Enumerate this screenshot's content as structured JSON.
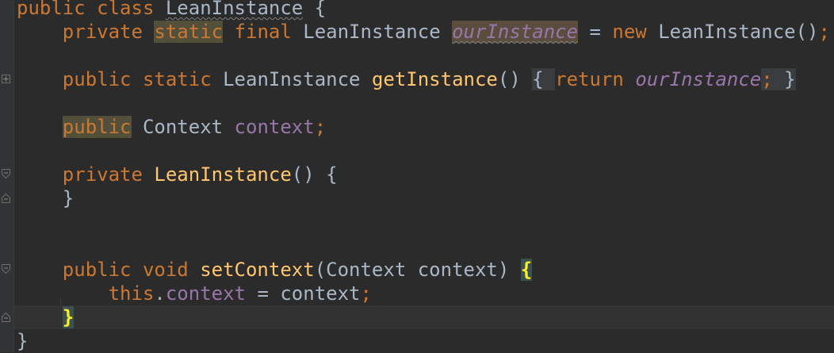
{
  "editor": {
    "lines": [
      {
        "parts": [
          {
            "t": "public class ",
            "c": "kw"
          },
          {
            "t": "LeanInstance",
            "c": "squiggle"
          },
          {
            "t": " {",
            "c": ""
          }
        ]
      },
      {
        "parts": [
          {
            "t": "    ",
            "c": ""
          },
          {
            "t": "private ",
            "c": "kw"
          },
          {
            "t": "static",
            "c": "kw hl-usage"
          },
          {
            "t": " ",
            "c": ""
          },
          {
            "t": "final ",
            "c": "kw"
          },
          {
            "t": "LeanInstance ",
            "c": ""
          },
          {
            "t": "ourInstance",
            "c": "fld it hl-ref squiggle"
          },
          {
            "t": " = ",
            "c": ""
          },
          {
            "t": "new ",
            "c": "kw"
          },
          {
            "t": "LeanInstance()",
            "c": ""
          },
          {
            "t": ";",
            "c": "kw"
          }
        ]
      },
      {
        "parts": []
      },
      {
        "parts": [
          {
            "t": "    ",
            "c": ""
          },
          {
            "t": "public static ",
            "c": "kw"
          },
          {
            "t": "LeanInstance ",
            "c": ""
          },
          {
            "t": "getInstance",
            "c": "fn"
          },
          {
            "t": "() ",
            "c": ""
          },
          {
            "t": "{ ",
            "c": "fold-region"
          },
          {
            "t": "return ",
            "c": "kw"
          },
          {
            "t": "ourInstance",
            "c": "fld it"
          },
          {
            "t": "; ",
            "c": "kw fold-region"
          },
          {
            "t": "}",
            "c": "fold-region"
          }
        ]
      },
      {
        "parts": []
      },
      {
        "parts": [
          {
            "t": "    ",
            "c": ""
          },
          {
            "t": "public",
            "c": "kw hl-usage"
          },
          {
            "t": " ",
            "c": ""
          },
          {
            "t": "Context ",
            "c": ""
          },
          {
            "t": "context",
            "c": "fld"
          },
          {
            "t": ";",
            "c": "kw"
          }
        ]
      },
      {
        "parts": []
      },
      {
        "parts": [
          {
            "t": "    ",
            "c": ""
          },
          {
            "t": "private ",
            "c": "kw"
          },
          {
            "t": "LeanInstance",
            "c": "fn"
          },
          {
            "t": "() {",
            "c": ""
          }
        ]
      },
      {
        "parts": [
          {
            "t": "    }",
            "c": ""
          }
        ]
      },
      {
        "parts": []
      },
      {
        "parts": []
      },
      {
        "parts": [
          {
            "t": "    ",
            "c": ""
          },
          {
            "t": "public void ",
            "c": "kw"
          },
          {
            "t": "setContext",
            "c": "fn"
          },
          {
            "t": "(Context context) ",
            "c": ""
          },
          {
            "t": "{",
            "c": "brace-match"
          }
        ]
      },
      {
        "parts": [
          {
            "t": "        ",
            "c": ""
          },
          {
            "t": "this",
            "c": "kw"
          },
          {
            "t": ".",
            "c": ""
          },
          {
            "t": "context",
            "c": "fld"
          },
          {
            "t": " = context",
            "c": ""
          },
          {
            "t": ";",
            "c": "kw"
          }
        ]
      },
      {
        "parts": [
          {
            "t": "    ",
            "c": ""
          },
          {
            "t": "}",
            "c": "brace-match"
          }
        ]
      },
      {
        "parts": [
          {
            "t": "}",
            "c": ""
          }
        ]
      }
    ]
  },
  "gutter": {
    "fold_markers": [
      {
        "line": 3,
        "icon": "fold-collapsed-plus-icon"
      },
      {
        "line": 7,
        "icon": "fold-start-icon"
      },
      {
        "line": 8,
        "icon": "fold-end-icon"
      },
      {
        "line": 11,
        "icon": "fold-start-icon"
      },
      {
        "line": 13,
        "icon": "fold-end-icon"
      }
    ]
  }
}
